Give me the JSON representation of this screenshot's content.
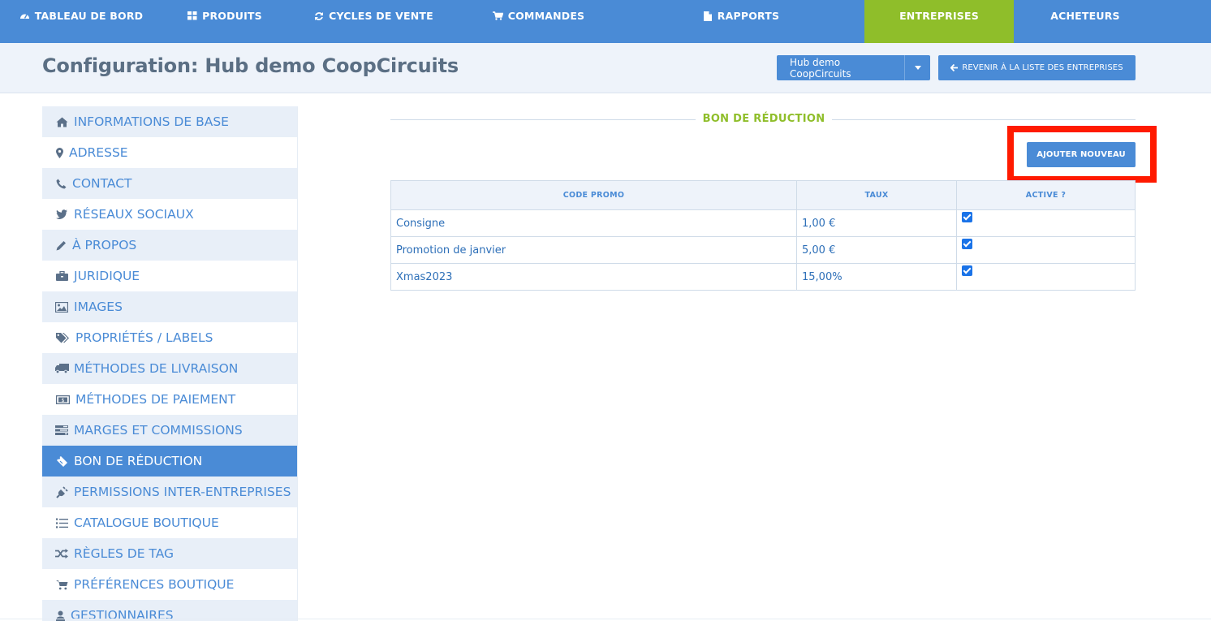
{
  "nav": {
    "items": [
      {
        "label": "TABLEAU DE BORD",
        "icon": "dashboard-icon"
      },
      {
        "label": "PRODUITS",
        "icon": "grid-icon"
      },
      {
        "label": "CYCLES DE VENTE",
        "icon": "refresh-icon"
      },
      {
        "label": "COMMANDES",
        "icon": "cart-icon"
      },
      {
        "label": "RAPPORTS",
        "icon": "file-icon"
      },
      {
        "label": "ENTREPRISES",
        "icon": "",
        "active": true
      },
      {
        "label": "ACHETEURS",
        "icon": ""
      }
    ]
  },
  "header": {
    "title": "Configuration: Hub demo CoopCircuits",
    "hub_select": "Hub demo CoopCircuits",
    "back_button": "REVENIR À LA LISTE DES ENTREPRISES"
  },
  "sidebar": {
    "items": [
      {
        "label": "INFORMATIONS DE BASE",
        "icon": "home-icon"
      },
      {
        "label": "ADRESSE",
        "icon": "map-marker-icon"
      },
      {
        "label": "CONTACT",
        "icon": "phone-icon"
      },
      {
        "label": "RÉSEAUX SOCIAUX",
        "icon": "twitter-icon"
      },
      {
        "label": "À PROPOS",
        "icon": "pencil-icon"
      },
      {
        "label": "JURIDIQUE",
        "icon": "briefcase-icon"
      },
      {
        "label": "IMAGES",
        "icon": "image-icon"
      },
      {
        "label": "PROPRIÉTÉS / LABELS",
        "icon": "tags-icon"
      },
      {
        "label": "MÉTHODES DE LIVRAISON",
        "icon": "truck-icon"
      },
      {
        "label": "MÉTHODES DE PAIEMENT",
        "icon": "money-icon"
      },
      {
        "label": "MARGES ET COMMISSIONS",
        "icon": "tasks-icon"
      },
      {
        "label": "BON DE RÉDUCTION",
        "icon": "ticket-icon",
        "active": true
      },
      {
        "label": "PERMISSIONS INTER-ENTREPRISES",
        "icon": "plug-icon"
      },
      {
        "label": "CATALOGUE BOUTIQUE",
        "icon": "list-icon"
      },
      {
        "label": "RÈGLES DE TAG",
        "icon": "random-icon"
      },
      {
        "label": "PRÉFÉRENCES BOUTIQUE",
        "icon": "cart-icon"
      },
      {
        "label": "GESTIONNAIRES",
        "icon": "user-icon"
      }
    ]
  },
  "main": {
    "section_title": "BON DE RÉDUCTION",
    "add_button": "AJOUTER NOUVEAU",
    "table": {
      "columns": [
        "CODE PROMO",
        "TAUX",
        "ACTIVE ?"
      ],
      "rows": [
        {
          "code": "Consigne",
          "rate": "1,00 €",
          "active": true
        },
        {
          "code": "Promotion de janvier",
          "rate": "5,00 €",
          "active": true
        },
        {
          "code": "Xmas2023",
          "rate": "15,00%",
          "active": true
        }
      ]
    }
  },
  "colors": {
    "primary": "#4a8bd6",
    "accent_green": "#8fbe2a",
    "highlight_red": "#ff1a00",
    "header_bg": "#eef3fa"
  }
}
